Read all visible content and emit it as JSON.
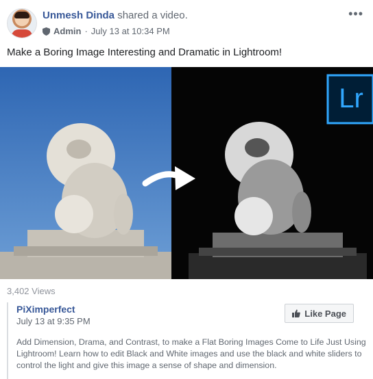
{
  "post": {
    "author": "Unmesh Dinda",
    "action": "shared a video.",
    "role": "Admin",
    "separator": "·",
    "timestamp": "July 13 at 10:34 PM",
    "more_label": "•••",
    "text": "Make a Boring Image Interesting and Dramatic in Lightroom!"
  },
  "video": {
    "badge": "Lr",
    "views": "3,402 Views"
  },
  "shared_page": {
    "name": "PiXimperfect",
    "date": "July 13 at 9:35 PM",
    "like_label": "Like Page",
    "description": "Add Dimension, Drama, and Contrast, to make a Flat Boring Images Come to Life Just Using Lightroom! Learn how to edit Black and White images and use the black and white sliders to control the light and give this image a sense of shape and dimension."
  },
  "colors": {
    "link": "#385898",
    "secondary": "#606770",
    "sky": "#3d76c0",
    "lr_badge": "#31a8ff"
  },
  "icons": [
    "shield-icon",
    "more-options-icon",
    "arrow-right-icon",
    "thumbs-up-icon"
  ]
}
